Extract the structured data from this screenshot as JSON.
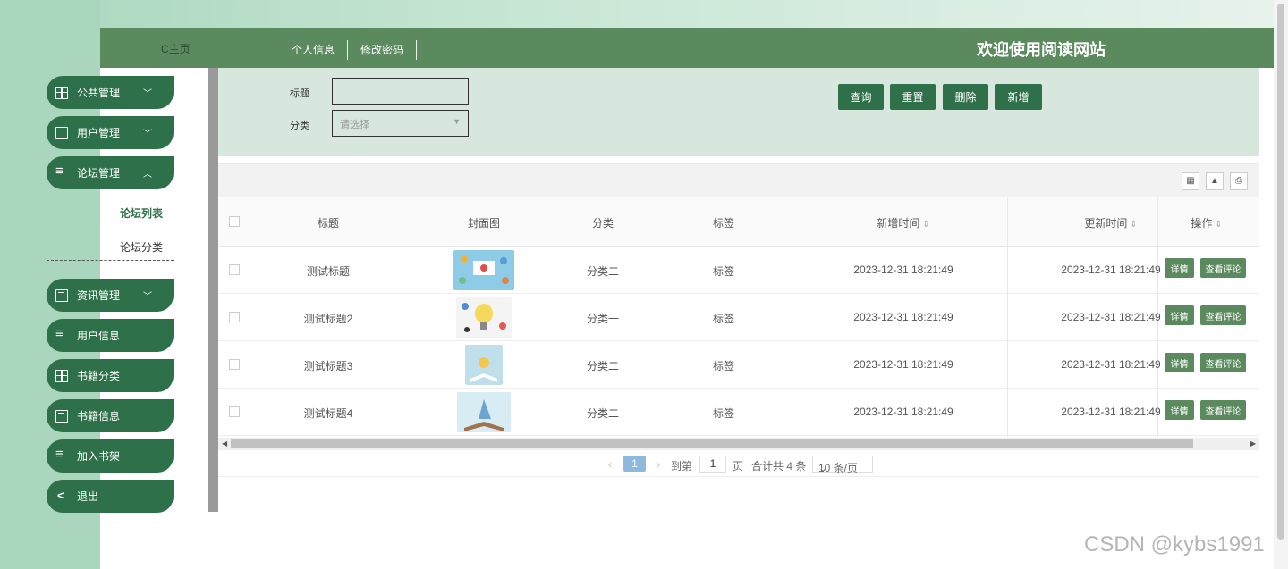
{
  "topbar": {
    "brand": "C主页",
    "nav": [
      "个人信息",
      "修改密码"
    ],
    "welcome": "欢迎使用阅读网站"
  },
  "sidebar": {
    "items": [
      {
        "label": "公共管理",
        "icon": "grid-icon",
        "chevron": "﹀"
      },
      {
        "label": "用户管理",
        "icon": "book-icon",
        "chevron": "﹀"
      },
      {
        "label": "论坛管理",
        "icon": "list-icon",
        "chevron": "︿"
      },
      {
        "label": "资讯管理",
        "icon": "book-icon",
        "chevron": "﹀"
      },
      {
        "label": "用户信息",
        "icon": "list-icon"
      },
      {
        "label": "书籍分类",
        "icon": "grid-icon"
      },
      {
        "label": "书籍信息",
        "icon": "book-icon"
      },
      {
        "label": "加入书架",
        "icon": "list-icon"
      },
      {
        "label": "退出",
        "icon": "share-icon"
      }
    ],
    "subitems": [
      "论坛列表",
      "论坛分类"
    ]
  },
  "search": {
    "title_label": "标题",
    "title_value": "",
    "category_label": "分类",
    "category_placeholder": "请选择",
    "buttons": [
      "查询",
      "重置",
      "删除",
      "新增"
    ]
  },
  "table": {
    "headers": [
      "标题",
      "封面图",
      "分类",
      "标签",
      "新增时间",
      "更新时间",
      "操作"
    ],
    "rows": [
      {
        "title": "测试标题",
        "category": "分类二",
        "tag": "标签",
        "created": "2023-12-31 18:21:49",
        "updated": "2023-12-31 18:21:49"
      },
      {
        "title": "测试标题2",
        "category": "分类一",
        "tag": "标签",
        "created": "2023-12-31 18:21:49",
        "updated": "2023-12-31 18:21:49"
      },
      {
        "title": "测试标题3",
        "category": "分类二",
        "tag": "标签",
        "created": "2023-12-31 18:21:49",
        "updated": "2023-12-31 18:21:49"
      },
      {
        "title": "测试标题4",
        "category": "分类二",
        "tag": "标签",
        "created": "2023-12-31 18:21:49",
        "updated": "2023-12-31 18:21:49"
      }
    ],
    "actions": [
      "详情",
      "查看评论"
    ]
  },
  "pager": {
    "current": "1",
    "goto_label": "到第",
    "goto_value": "1",
    "page_label": "页",
    "total": "合计共 4 条",
    "size": "10 条/页"
  },
  "watermark": "CSDN @kybs1991",
  "colors": {
    "primary": "#2e7049",
    "topbar": "#5c8a5f",
    "panel": "#d7e7dd"
  }
}
